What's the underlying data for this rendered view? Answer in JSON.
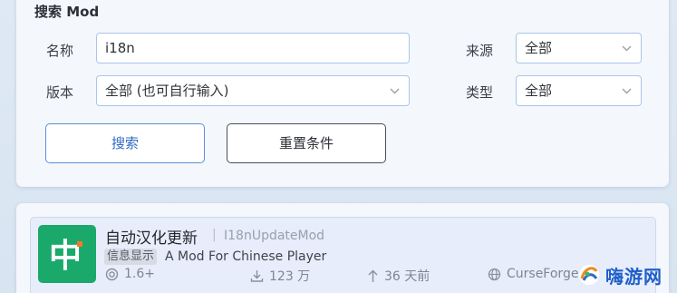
{
  "search": {
    "title": "搜索 Mod",
    "name_label": "名称",
    "name_value": "i18n",
    "version_label": "版本",
    "version_value": "全部 (也可自行输入)",
    "source_label": "来源",
    "source_value": "全部",
    "type_label": "类型",
    "type_value": "全部",
    "search_button": "搜索",
    "reset_button": "重置条件"
  },
  "result": {
    "logo_glyph": "中",
    "title": "自动汉化更新",
    "separator": "|",
    "slug": "I18nUpdateMod",
    "tag": "信息显示",
    "description": "A Mod For Chinese Player",
    "version": "1.6+",
    "downloads": "123 万",
    "updated": "36 天前",
    "platform": "CurseForge"
  },
  "watermark": {
    "text": "嗨游网"
  },
  "colors": {
    "accent": "#2f6bc3",
    "logo_bg": "#1aa96a",
    "page_bg": "#dfe9f5"
  },
  "icons": [
    "chevron-down-icon",
    "target-icon",
    "download-icon",
    "arrow-up-icon",
    "globe-icon",
    "watermark-logo-icon"
  ]
}
